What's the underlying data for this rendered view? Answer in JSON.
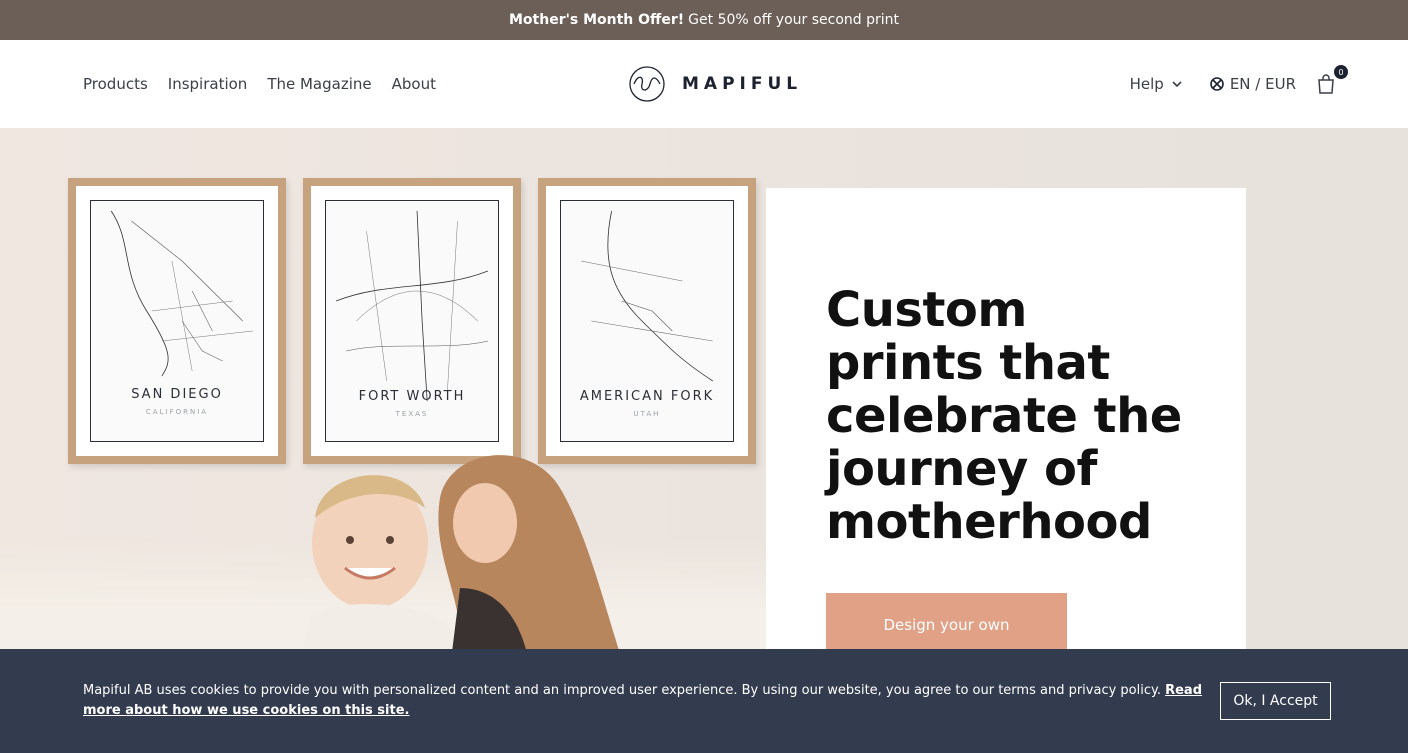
{
  "promo": {
    "bold": "Mother's Month Offer!",
    "text": "Get 50% off your second print"
  },
  "nav": {
    "items": [
      "Products",
      "Inspiration",
      "The Magazine",
      "About"
    ],
    "logo_text": "MAPIFUL",
    "help": "Help",
    "locale": "EN / EUR",
    "cart_count": "0"
  },
  "hero": {
    "title": "Custom prints that celebrate the journey of motherhood",
    "cta": "Design your own",
    "frames": [
      {
        "city": "SAN DIEGO",
        "region": "CALIFORNIA"
      },
      {
        "city": "FORT WORTH",
        "region": "TEXAS"
      },
      {
        "city": "AMERICAN FORK",
        "region": "UTAH"
      }
    ]
  },
  "cookie": {
    "text": "Mapiful AB uses cookies to provide you with personalized content and an improved user experience. By using our website, you agree to our terms and privacy policy. ",
    "link": "Read more about how we use cookies on this site.",
    "accept": "Ok, I Accept"
  },
  "colors": {
    "promo_bg": "#6b5f57",
    "cta_bg": "#e0a187",
    "cookie_bg": "#333b4e"
  }
}
